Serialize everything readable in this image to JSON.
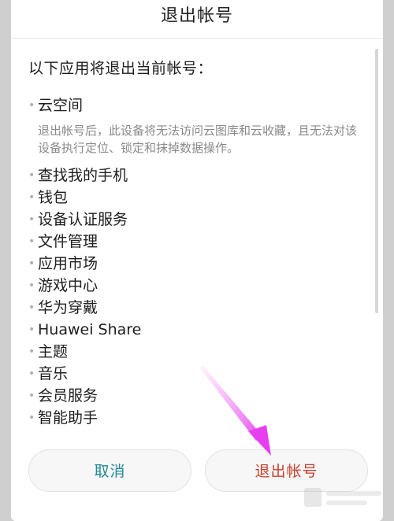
{
  "dialog": {
    "title": "退出帐号",
    "intro": "以下应用将退出当前帐号：",
    "first_item": {
      "label": "云空间",
      "description": "退出帐号后，此设备将无法访问云图库和云收藏，且无法对该设备执行定位、锁定和抹掉数据操作。"
    },
    "items": [
      "查找我的手机",
      "钱包",
      "设备认证服务",
      "文件管理",
      "应用市场",
      "游戏中心",
      "华为穿戴",
      "Huawei Share",
      "主题",
      "音乐",
      "会员服务",
      "智能助手"
    ],
    "buttons": {
      "cancel": "取消",
      "confirm": "退出帐号"
    }
  },
  "colors": {
    "cancel_text": "#1f8a96",
    "confirm_text": "#c8402e",
    "annotation_arrow": "#e83ef0"
  },
  "icons": {
    "annotation": "arrow-annotation-icon"
  }
}
